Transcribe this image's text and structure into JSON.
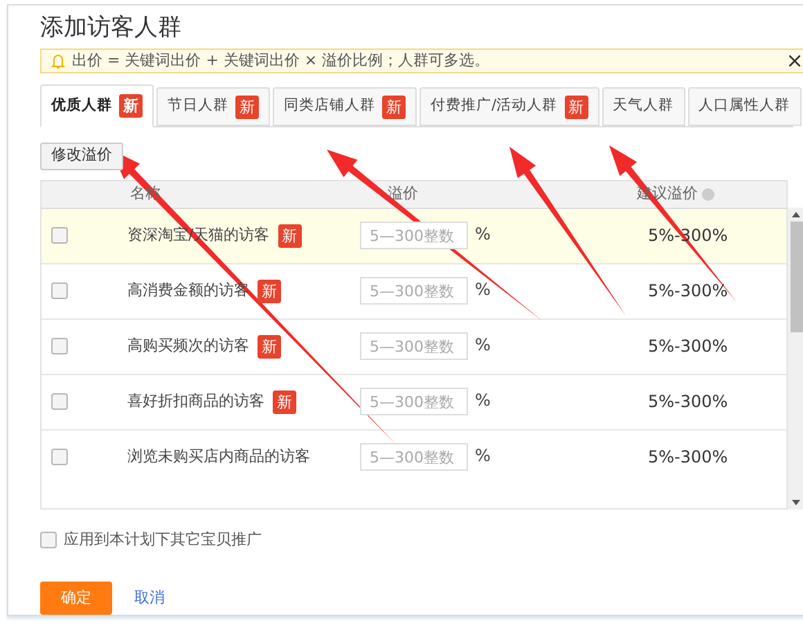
{
  "dialog": {
    "title": "添加访客人群"
  },
  "notice": {
    "text": "出价 = 关键词出价 + 关键词出价 × 溢价比例；人群可多选。"
  },
  "tabs": [
    {
      "label": "优质人群",
      "badge": "新",
      "selected": true
    },
    {
      "label": "节日人群",
      "badge": "新",
      "selected": false
    },
    {
      "label": "同类店铺人群",
      "badge": "新",
      "selected": false
    },
    {
      "label": "付费推广/活动人群",
      "badge": "新",
      "selected": false
    },
    {
      "label": "天气人群",
      "selected": false
    },
    {
      "label": "人口属性人群",
      "selected": false
    }
  ],
  "toolbar": {
    "button": "修改溢价"
  },
  "table": {
    "columns": [
      "名称",
      "溢价",
      "建议溢价"
    ],
    "rows": [
      {
        "name": "资深淘宝/天猫的访客",
        "badge": "新",
        "placeholder": "5—300整数",
        "unit": "%",
        "suggested": "5%-300%",
        "checked": false,
        "selected": true
      },
      {
        "name": "高消费金额的访客",
        "badge": "新",
        "placeholder": "5—300整数",
        "unit": "%",
        "suggested": "5%-300%",
        "checked": false,
        "selected": false
      },
      {
        "name": "高购买频次的访客",
        "badge": "新",
        "placeholder": "5—300整数",
        "unit": "%",
        "suggested": "5%-300%",
        "checked": false,
        "selected": false
      },
      {
        "name": "喜好折扣商品的访客",
        "badge": "新",
        "placeholder": "5—300整数",
        "unit": "%",
        "suggested": "5%-300%",
        "checked": false,
        "selected": false
      },
      {
        "name": "浏览未购买店内商品的访客",
        "placeholder": "5—300整数",
        "unit": "%",
        "suggested": "5%-300%",
        "checked": false,
        "selected": false
      }
    ]
  },
  "apply_all": {
    "label": "应用到本计划下其它宝贝推广",
    "checked": false
  },
  "buttons": {
    "confirm": "确定",
    "cancel": "取消"
  }
}
